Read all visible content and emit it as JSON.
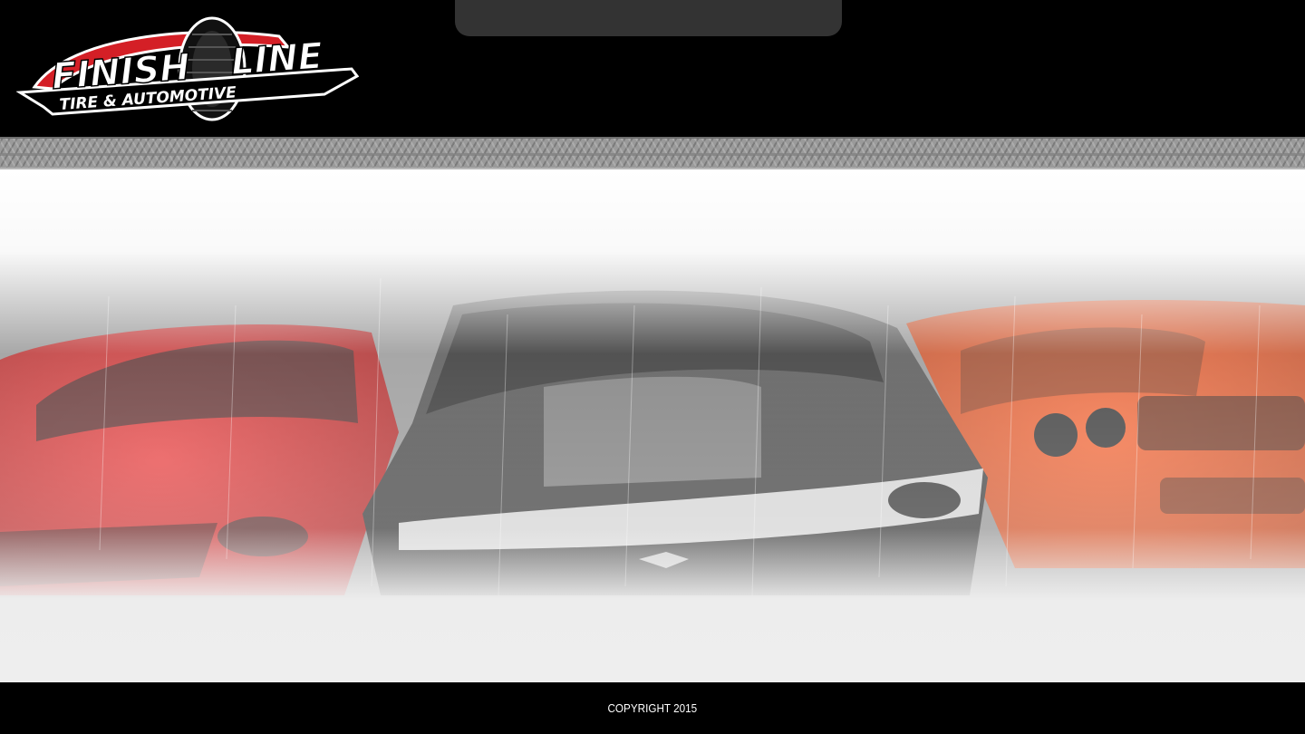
{
  "brand": {
    "logo_word1": "FINISH",
    "logo_word2": "LINE",
    "logo_subtitle": "TIRE & AUTOMOTIVE",
    "colors": {
      "red": "#d41f26",
      "black": "#000000",
      "white": "#ffffff"
    }
  },
  "header": {
    "tab_color": "#333333"
  },
  "hero": {
    "image_alt": "three cars",
    "icons": [
      "tread-strip",
      "cars-photo"
    ]
  },
  "footer": {
    "copyright": "COPYRIGHT 2015"
  }
}
